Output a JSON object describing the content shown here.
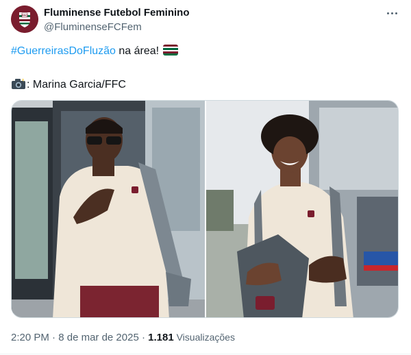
{
  "author": {
    "name": "Fluminense Futebol Feminino",
    "handle": "@FluminenseFCFem",
    "avatar_icon": "fluminense-crest-icon"
  },
  "tweet": {
    "hashtag": "#GuerreirasDoFluzão",
    "text_after_hashtag": " na área!",
    "flag_icon": "fluminense-flag-icon",
    "photo_credit_prefix": ":",
    "photo_credit": " Marina Garcia/FFC",
    "camera_icon": "camera-flash-icon"
  },
  "media": {
    "photos": [
      {
        "alt": "Player with sunglasses and backpack walking off the team bus"
      },
      {
        "alt": "Smiling player with curly hair holding a backpack"
      }
    ]
  },
  "meta": {
    "time": "2:20 PM",
    "separator1": " · ",
    "date": "8 de mar de 2025",
    "separator2": " · ",
    "views_count": "1.181",
    "views_label": " Visualizações"
  },
  "colors": {
    "link": "#1d9bf0",
    "secondary_text": "#536471",
    "primary_text": "#0f1419",
    "club_grena": "#7a1d2e",
    "club_green": "#006b3f"
  }
}
